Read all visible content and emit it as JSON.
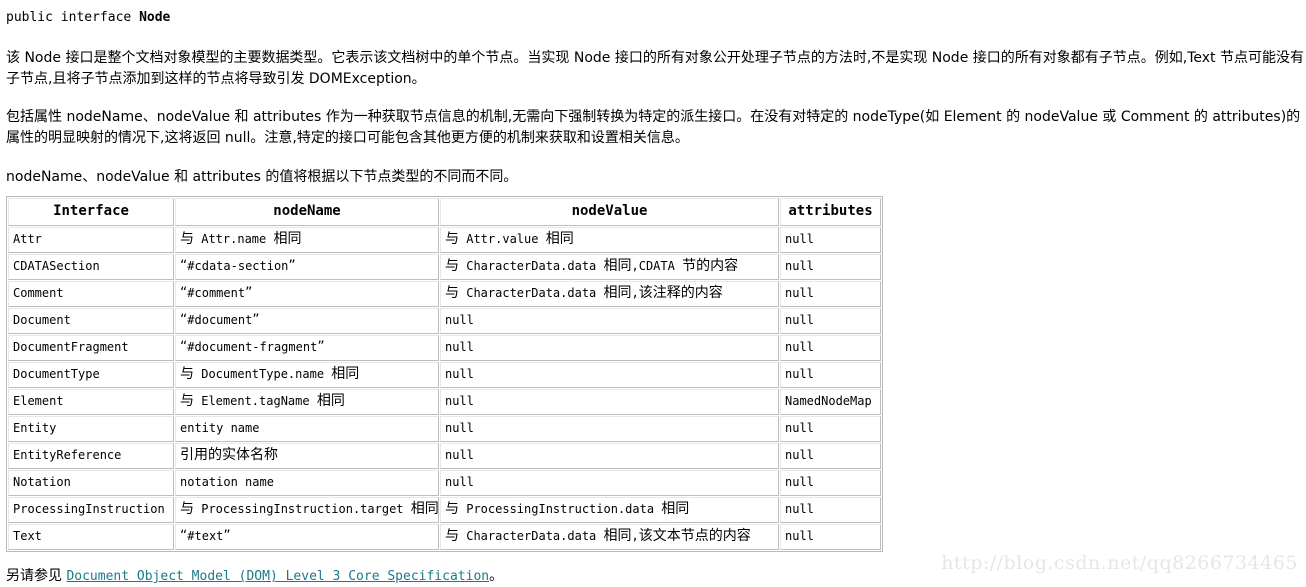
{
  "signature": {
    "keyword": "public interface ",
    "name": "Node"
  },
  "paragraphs": {
    "p1": "该 Node 接口是整个文档对象模型的主要数据类型。它表示该文档树中的单个节点。当实现 Node 接口的所有对象公开处理子节点的方法时,不是实现 Node 接口的所有对象都有子节点。例如,Text 节点可能没有子节点,且将子节点添加到这样的节点将导致引发 DOMException。",
    "p2": "包括属性 nodeName、nodeValue 和 attributes 作为一种获取节点信息的机制,无需向下强制转换为特定的派生接口。在没有对特定的 nodeType(如 Element 的 nodeValue 或 Comment 的 attributes)的属性的明显映射的情况下,这将返回 null。注意,特定的接口可能包含其他更方便的机制来获取和设置相关信息。",
    "p3": "nodeName、nodeValue 和 attributes 的值将根据以下节点类型的不同而不同。"
  },
  "table": {
    "headers": [
      "Interface",
      "nodeName",
      "nodeValue",
      "attributes"
    ],
    "rows": [
      {
        "interface": "Attr",
        "nodeName": "与 Attr.name 相同",
        "nodeValue": "与 Attr.value 相同",
        "attributes": "null"
      },
      {
        "interface": "CDATASection",
        "nodeName": "“#cdata-section”",
        "nodeValue": "与 CharacterData.data 相同,CDATA 节的内容",
        "attributes": "null"
      },
      {
        "interface": "Comment",
        "nodeName": "“#comment”",
        "nodeValue": "与 CharacterData.data 相同,该注释的内容",
        "attributes": "null"
      },
      {
        "interface": "Document",
        "nodeName": "“#document”",
        "nodeValue": "null",
        "attributes": "null"
      },
      {
        "interface": "DocumentFragment",
        "nodeName": "“#document-fragment”",
        "nodeValue": "null",
        "attributes": "null"
      },
      {
        "interface": "DocumentType",
        "nodeName": "与 DocumentType.name 相同",
        "nodeValue": "null",
        "attributes": "null"
      },
      {
        "interface": "Element",
        "nodeName": "与 Element.tagName 相同",
        "nodeValue": "null",
        "attributes": "NamedNodeMap"
      },
      {
        "interface": "Entity",
        "nodeName": "entity name",
        "nodeValue": "null",
        "attributes": "null"
      },
      {
        "interface": "EntityReference",
        "nodeName": "引用的实体名称",
        "nodeValue": "null",
        "attributes": "null"
      },
      {
        "interface": "Notation",
        "nodeName": "notation name",
        "nodeValue": "null",
        "attributes": "null"
      },
      {
        "interface": "ProcessingInstruction",
        "nodeName": "与 ProcessingInstruction.target 相同",
        "nodeValue": "与 ProcessingInstruction.data 相同",
        "attributes": "null"
      },
      {
        "interface": "Text",
        "nodeName": "“#text”",
        "nodeValue": "与 CharacterData.data 相同,该文本节点的内容",
        "attributes": "null"
      }
    ]
  },
  "footer": {
    "prefix": "另请参见 ",
    "link_text": "Document Object Model (DOM) Level 3 Core Specification",
    "suffix": "。",
    "link_color": "#1a7a8c"
  },
  "watermark": {
    "text": "http://blog.csdn.net/qq8266734465",
    "color": "#e6e6e6"
  }
}
